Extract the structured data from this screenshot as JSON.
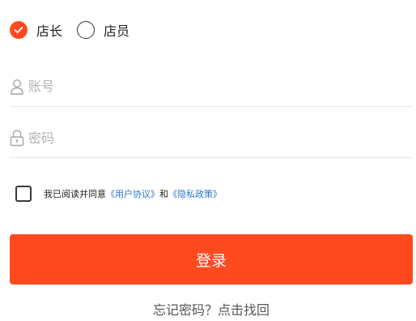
{
  "role_selector": {
    "options": [
      {
        "label": "店长",
        "selected": true
      },
      {
        "label": "店员",
        "selected": false
      }
    ]
  },
  "account_field": {
    "icon": "user-icon",
    "placeholder": "账号",
    "value": ""
  },
  "password_field": {
    "icon": "lock-icon",
    "placeholder": "密码",
    "value": ""
  },
  "agreement": {
    "checked": false,
    "prefix": "我已阅读并同意",
    "user_agreement_link": "《用户协议》",
    "conjunction": "和",
    "privacy_policy_link": "《隐私政策》"
  },
  "login_button": {
    "label": "登录"
  },
  "forgot_password": {
    "label": "忘记密码？点击找回"
  },
  "colors": {
    "accent": "#ff4a1f",
    "link": "#2a76d2",
    "placeholder": "#b3b3b3",
    "divider": "#e6e6e6"
  }
}
